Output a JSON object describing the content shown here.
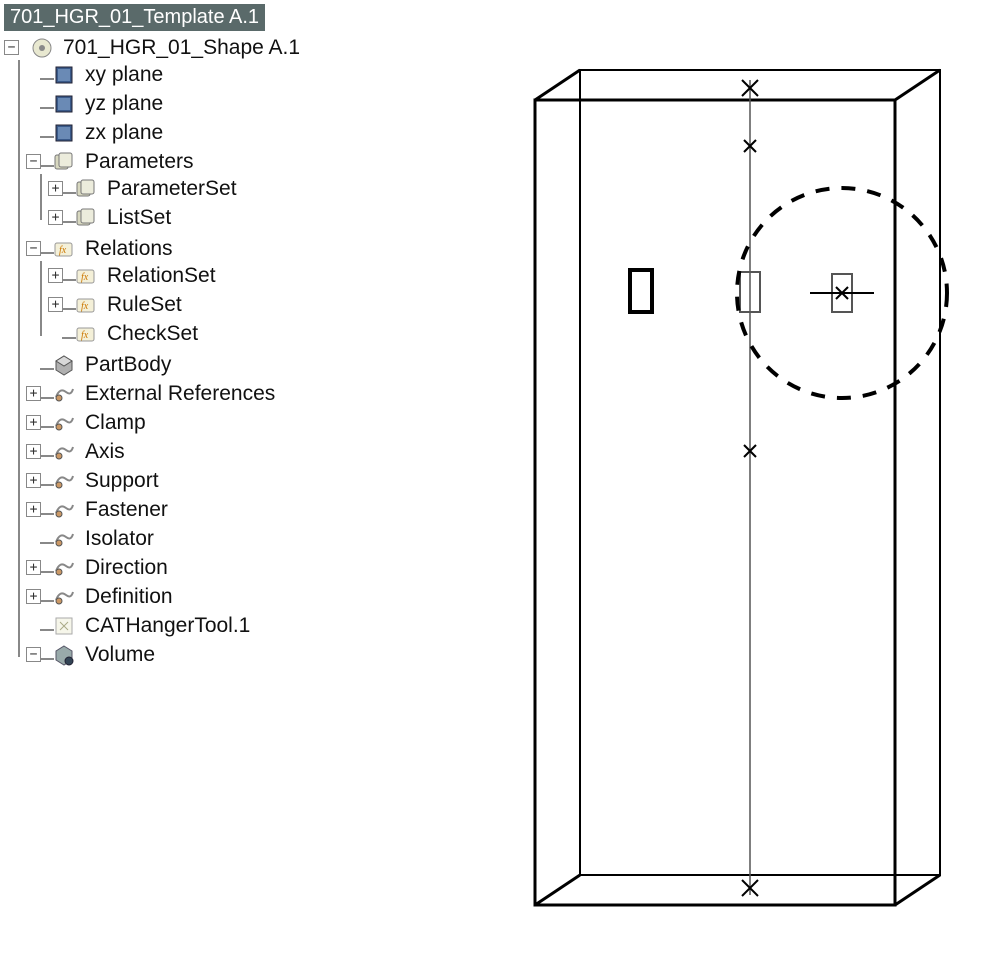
{
  "root": {
    "label": "701_HGR_01_Template A.1"
  },
  "tree": [
    {
      "exp": "-",
      "icon": "part",
      "label": "701_HGR_01_Shape A.1",
      "children": [
        {
          "exp": "",
          "icon": "plane",
          "label": "xy plane"
        },
        {
          "exp": "",
          "icon": "plane",
          "label": "yz plane"
        },
        {
          "exp": "",
          "icon": "plane",
          "label": "zx plane"
        },
        {
          "exp": "-",
          "icon": "params",
          "label": "Parameters",
          "children": [
            {
              "exp": "+",
              "icon": "params",
              "label": "ParameterSet"
            },
            {
              "exp": "+",
              "icon": "params",
              "label": "ListSet"
            }
          ]
        },
        {
          "exp": "-",
          "icon": "relation",
          "label": "Relations",
          "children": [
            {
              "exp": "+",
              "icon": "relation",
              "label": "RelationSet"
            },
            {
              "exp": "+",
              "icon": "relation",
              "label": "RuleSet"
            },
            {
              "exp": "",
              "icon": "relation",
              "label": "CheckSet"
            }
          ]
        },
        {
          "exp": "",
          "icon": "body",
          "label": "PartBody"
        },
        {
          "exp": "+",
          "icon": "geoset",
          "label": "External References"
        },
        {
          "exp": "+",
          "icon": "geoset",
          "label": "Clamp"
        },
        {
          "exp": "+",
          "icon": "geoset",
          "label": "Axis"
        },
        {
          "exp": "+",
          "icon": "geoset",
          "label": "Support"
        },
        {
          "exp": "+",
          "icon": "geoset",
          "label": "Fastener"
        },
        {
          "exp": "",
          "icon": "geoset",
          "label": "Isolator"
        },
        {
          "exp": "+",
          "icon": "geoset",
          "label": "Direction"
        },
        {
          "exp": "+",
          "icon": "geoset",
          "label": "Definition"
        },
        {
          "exp": "",
          "icon": "hanger",
          "label": "CATHangerTool.1"
        },
        {
          "exp": "-",
          "icon": "volume",
          "label": "Volume"
        }
      ]
    }
  ],
  "viewport": {
    "description": "3D wireframe bounding-box with center axis, three small rectangular reference planes, cross markers and a dashed highlight circle around the rightmost plane"
  }
}
